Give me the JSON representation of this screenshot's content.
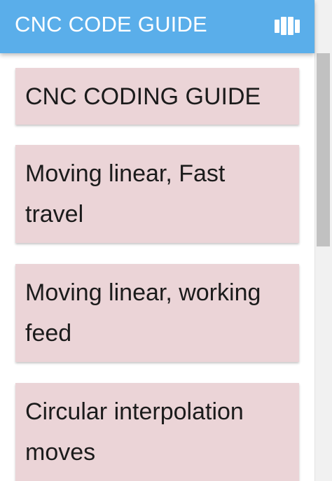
{
  "app_bar": {
    "title": "CNC CODE GUIDE",
    "action_icon": "book-open-icon",
    "background_color": "#5aaeea"
  },
  "list": {
    "card_color": "#ebd4d7",
    "items": [
      {
        "label": "CNC CODING GUIDE"
      },
      {
        "label": "Moving linear, Fast travel"
      },
      {
        "label": "Moving linear, working feed"
      },
      {
        "label": "Circular interpolation moves"
      }
    ]
  }
}
